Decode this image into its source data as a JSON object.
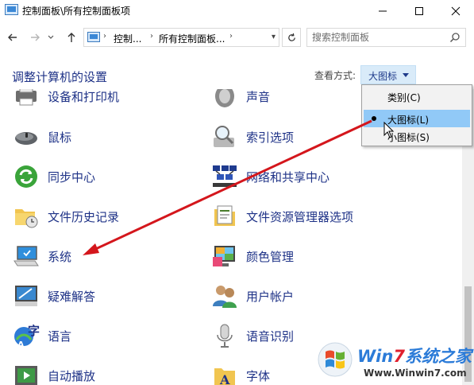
{
  "window": {
    "title": "控制面板\\所有控制面板项",
    "minimize_icon": "minimize-icon",
    "maximize_icon": "maximize-icon",
    "close_icon": "close-icon"
  },
  "address": {
    "crumbs": [
      "控制...",
      "所有控制面板..."
    ],
    "search_placeholder": "搜索控制面板"
  },
  "header": {
    "title": "调整计算机的设置",
    "view_by_label": "查看方式:",
    "view_by_value": "大图标"
  },
  "view_menu": {
    "options": [
      "类别(C)",
      "大图标(L)",
      "小图标(S)"
    ],
    "selected": "大图标(L)"
  },
  "items": [
    {
      "label": "设备和打印机",
      "icon": "printer-icon"
    },
    {
      "label": "声音",
      "icon": "speaker-icon"
    },
    {
      "label": "鼠标",
      "icon": "mouse-icon"
    },
    {
      "label": "索引选项",
      "icon": "indexing-icon"
    },
    {
      "label": "同步中心",
      "icon": "sync-icon"
    },
    {
      "label": "网络和共享中心",
      "icon": "network-icon"
    },
    {
      "label": "文件历史记录",
      "icon": "file-history-icon"
    },
    {
      "label": "文件资源管理器选项",
      "icon": "folder-options-icon"
    },
    {
      "label": "系统",
      "icon": "system-icon"
    },
    {
      "label": "颜色管理",
      "icon": "color-management-icon"
    },
    {
      "label": "疑难解答",
      "icon": "troubleshooting-icon"
    },
    {
      "label": "用户帐户",
      "icon": "user-accounts-icon"
    },
    {
      "label": "语言",
      "icon": "language-icon"
    },
    {
      "label": "语音识别",
      "icon": "speech-recognition-icon"
    },
    {
      "label": "自动播放",
      "icon": "autoplay-icon"
    },
    {
      "label": "字体",
      "icon": "fonts-icon"
    }
  ],
  "watermark": {
    "brand_win": "Win",
    "brand_7": "7",
    "brand_rest": "系统之家",
    "url": "Www.Winwin7.com"
  },
  "colors": {
    "link": "#1e3287",
    "annotation_arrow": "#d4161c",
    "menu_highlight": "#91c9f7",
    "view_button": "#d9ebf9"
  }
}
